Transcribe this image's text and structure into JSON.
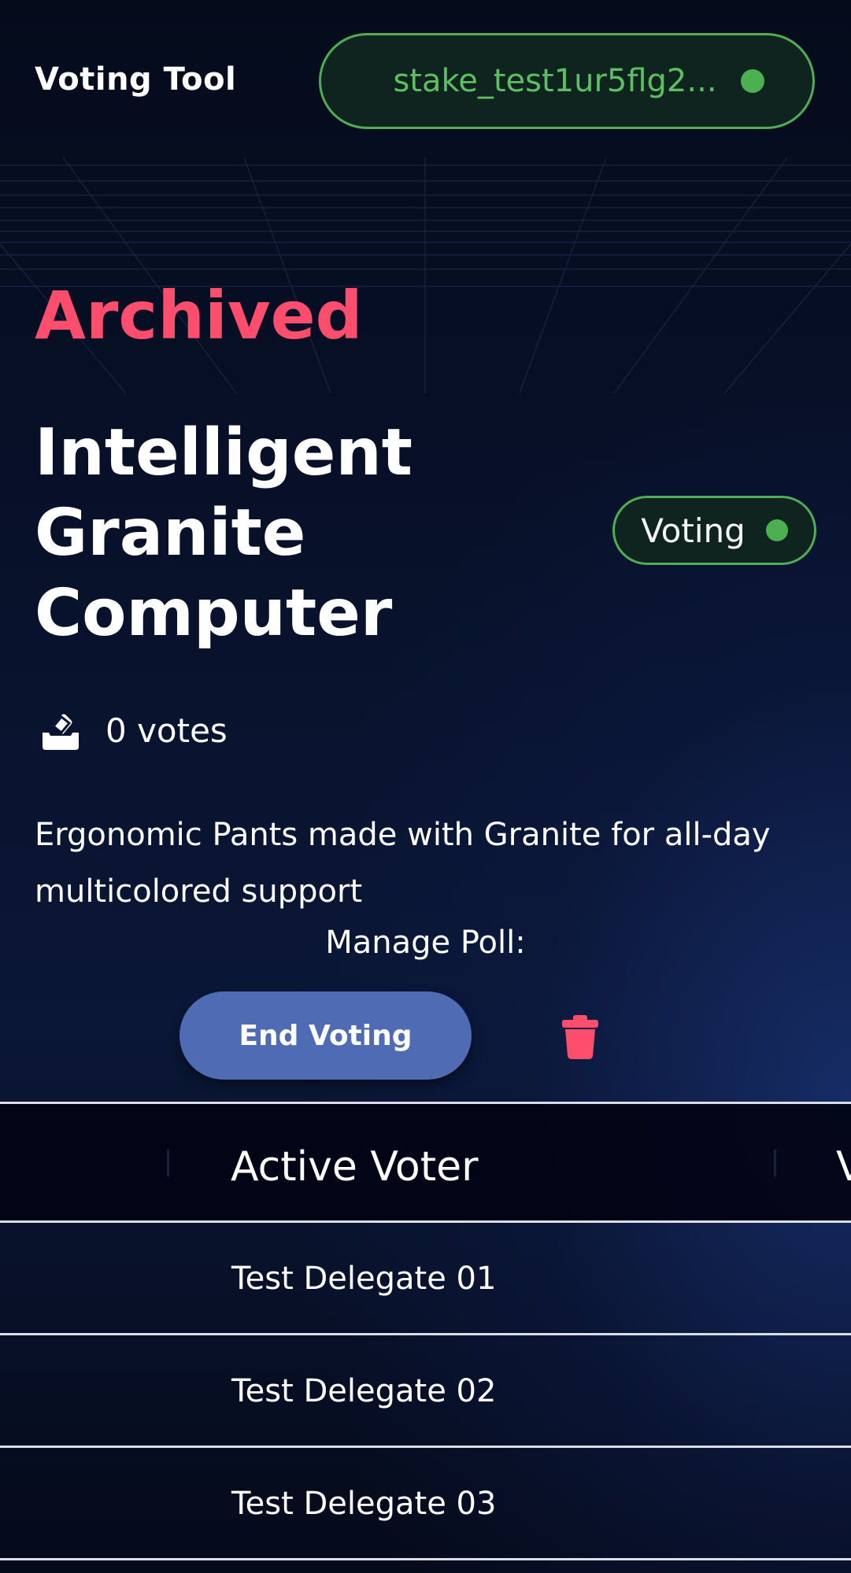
{
  "header": {
    "app_title": "Voting Tool",
    "wallet_address": "stake_test1ur5flg2...",
    "wallet_status_color": "#4caf50"
  },
  "poll": {
    "state_label": "Archived",
    "title": "Intelligent Granite Computer",
    "status_label": "Voting",
    "votes_text": "0 votes",
    "description": "Ergonomic Pants made with Granite for all-day multicolored support",
    "manage_label": "Manage Poll:",
    "end_voting_label": "End Voting",
    "delete_icon": "trash-icon",
    "ballot_icon": "ballot-icon"
  },
  "table": {
    "columns": [
      "Active Voter",
      "V"
    ],
    "rows": [
      {
        "name": "Test Delegate 01"
      },
      {
        "name": "Test Delegate 02"
      },
      {
        "name": "Test Delegate 03"
      }
    ]
  },
  "colors": {
    "accent_red": "#ff4d6d",
    "accent_green": "#4caf50",
    "button_blue": "#4e6bb3",
    "background": "#050b1c"
  }
}
